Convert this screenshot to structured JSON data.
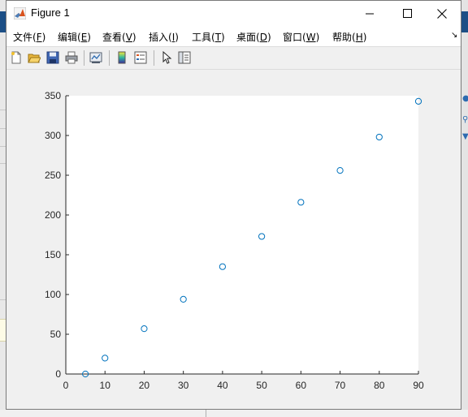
{
  "window": {
    "title": "Figure 1",
    "controls": [
      "minimize",
      "maximize",
      "close"
    ]
  },
  "menu": {
    "items": [
      {
        "label": "文件(",
        "key": "F",
        "suffix": ")"
      },
      {
        "label": "编辑(",
        "key": "E",
        "suffix": ")"
      },
      {
        "label": "查看(",
        "key": "V",
        "suffix": ")"
      },
      {
        "label": "插入(",
        "key": "I",
        "suffix": ")"
      },
      {
        "label": "工具(",
        "key": "T",
        "suffix": ")"
      },
      {
        "label": "桌面(",
        "key": "D",
        "suffix": ")"
      },
      {
        "label": "窗口(",
        "key": "W",
        "suffix": ")"
      },
      {
        "label": "帮助(",
        "key": "H",
        "suffix": ")"
      }
    ],
    "overflow_icon": "dock-arrow-icon"
  },
  "toolbar": {
    "buttons": [
      "new-figure-icon",
      "open-file-icon",
      "save-icon",
      "print-icon",
      "link-plot-icon",
      "colorbar-icon",
      "legend-icon",
      "edit-plot-icon",
      "property-inspector-icon"
    ]
  },
  "chart_data": {
    "type": "scatter",
    "title": "",
    "xlabel": "",
    "ylabel": "",
    "xlim": [
      0,
      90
    ],
    "ylim": [
      0,
      350
    ],
    "xticks": [
      0,
      10,
      20,
      30,
      40,
      50,
      60,
      70,
      80,
      90
    ],
    "yticks": [
      0,
      50,
      100,
      150,
      200,
      250,
      300,
      350
    ],
    "grid": false,
    "marker": "open-circle",
    "color": "#0072bd",
    "x": [
      5,
      10,
      20,
      30,
      40,
      50,
      60,
      70,
      80,
      90
    ],
    "y": [
      0,
      20,
      57,
      94,
      135,
      173,
      216,
      256,
      298,
      343
    ]
  }
}
